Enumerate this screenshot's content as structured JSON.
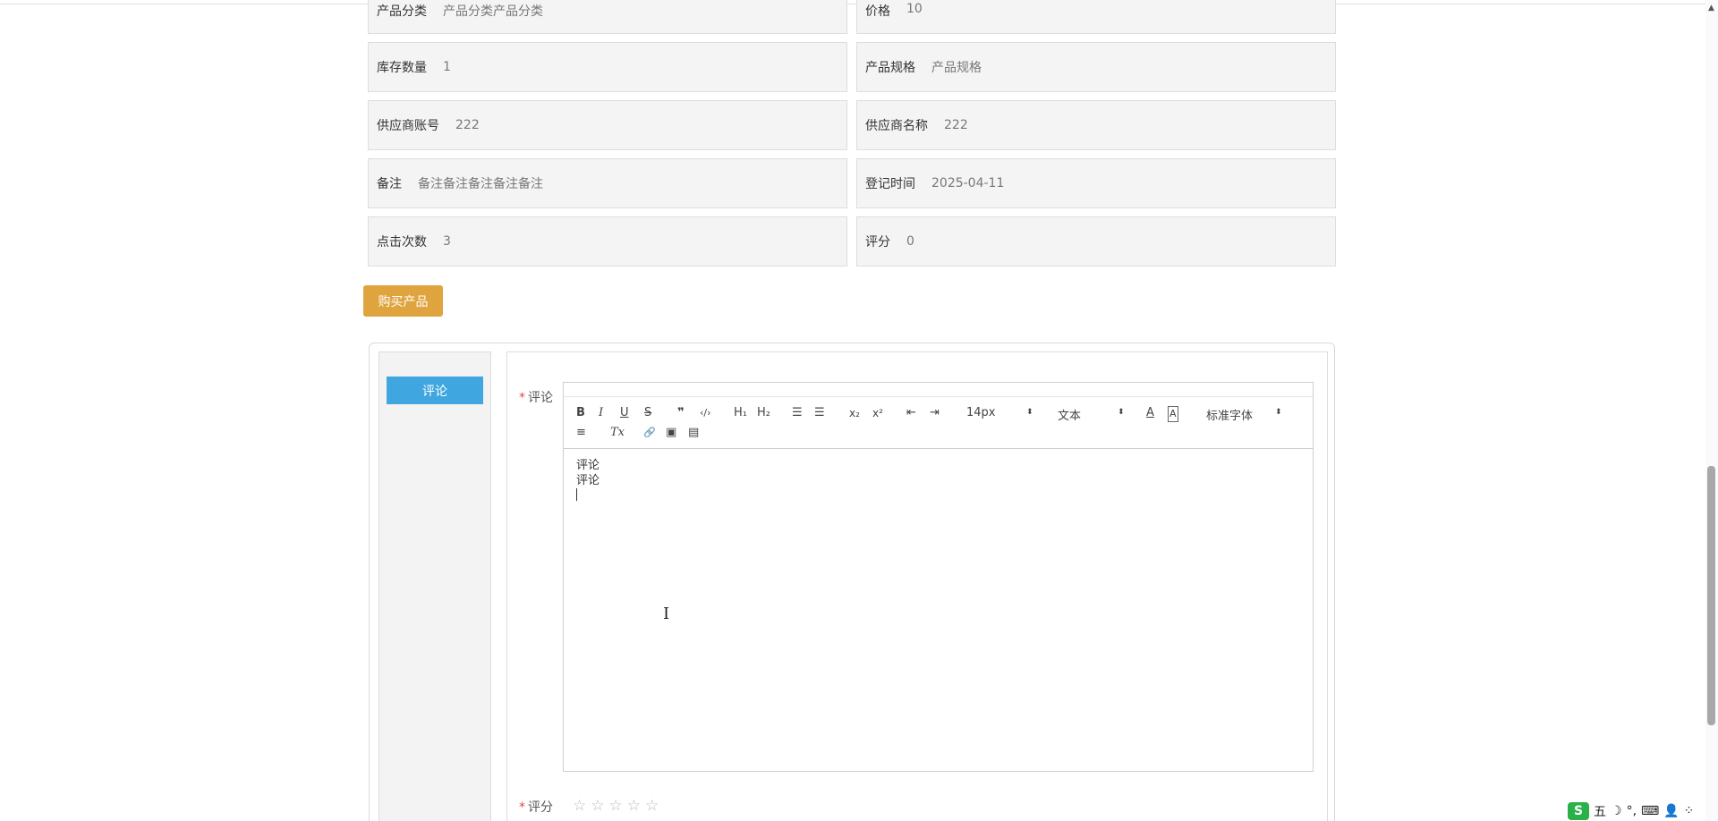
{
  "info_rows": [
    [
      {
        "label": "产品分类",
        "value": "产品分类产品分类"
      },
      {
        "label": "价格",
        "value": "10"
      }
    ],
    [
      {
        "label": "库存数量",
        "value": "1"
      },
      {
        "label": "产品规格",
        "value": "产品规格"
      }
    ],
    [
      {
        "label": "供应商账号",
        "value": "222"
      },
      {
        "label": "供应商名称",
        "value": "222"
      }
    ],
    [
      {
        "label": "备注",
        "value": "备注备注备注备注备注"
      },
      {
        "label": "登记时间",
        "value": "2025-04-11"
      }
    ],
    [
      {
        "label": "点击次数",
        "value": "3"
      },
      {
        "label": "评分",
        "value": "0"
      }
    ]
  ],
  "buy_button": "购买产品",
  "comment_tab": "评论",
  "form": {
    "required_mark": "*",
    "comment_label": "评论",
    "rating_label": "评分",
    "rating_value": 0,
    "rating_max": 5
  },
  "toolbar": {
    "bold": "B",
    "italic": "I",
    "underline": "U",
    "strike": "S",
    "quote": "❞",
    "code": "‹/›",
    "h1": "H₁",
    "h2": "H₂",
    "ordered_list": "☰",
    "bullet_list": "☰",
    "subscript": "x₂",
    "superscript": "x²",
    "outdent": "⇤",
    "indent": "⇥",
    "size": "14px",
    "header": "文本",
    "font": "标准字体",
    "align": "≡",
    "clean": "Tx",
    "link": "🔗",
    "image": "▣",
    "video": "▤"
  },
  "editor_lines": [
    "评论",
    "评论"
  ],
  "ime": {
    "logo": "S",
    "mode": "五",
    "moon": "☽",
    "punct": "°,"
  },
  "colors": {
    "buy": "#e0a43f",
    "tab": "#3fa6df",
    "required": "#e64545"
  }
}
